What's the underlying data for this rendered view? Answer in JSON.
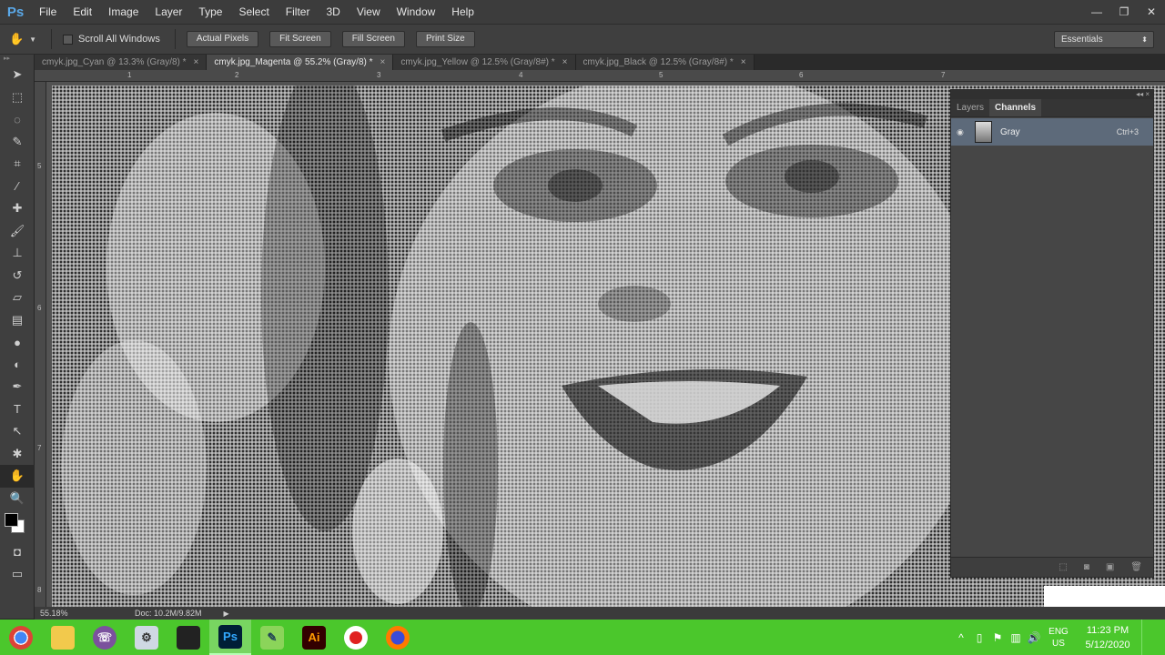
{
  "app": {
    "logo": "Ps"
  },
  "menu": [
    "File",
    "Edit",
    "Image",
    "Layer",
    "Type",
    "Select",
    "Filter",
    "3D",
    "View",
    "Window",
    "Help"
  ],
  "window_controls": {
    "minimize": "—",
    "restore": "❐",
    "close": "✕"
  },
  "options": {
    "tool_icon": "hand-icon",
    "scroll_all_windows": "Scroll All Windows",
    "buttons": [
      "Actual Pixels",
      "Fit Screen",
      "Fill Screen",
      "Print Size"
    ],
    "workspace": "Essentials"
  },
  "tabs": [
    {
      "label": "cmyk.jpg_Cyan @ 13.3% (Gray/8) *",
      "active": false
    },
    {
      "label": "cmyk.jpg_Magenta @ 55.2% (Gray/8) *",
      "active": true
    },
    {
      "label": "cmyk.jpg_Yellow @ 12.5% (Gray/8#) *",
      "active": false
    },
    {
      "label": "cmyk.jpg_Black @ 12.5% (Gray/8#) *",
      "active": false
    }
  ],
  "ruler_h": [
    "1",
    "2",
    "3",
    "4",
    "5",
    "6",
    "7"
  ],
  "ruler_v": [
    "5",
    "6",
    "7",
    "8"
  ],
  "tools": [
    "move-icon",
    "marquee-icon",
    "lasso-icon",
    "quick-select-icon",
    "crop-icon",
    "eyedropper-icon",
    "healing-icon",
    "brush-icon",
    "stamp-icon",
    "history-brush-icon",
    "eraser-icon",
    "gradient-icon",
    "blur-icon",
    "dodge-icon",
    "pen-icon",
    "type-icon",
    "path-select-icon",
    "shape-icon",
    "hand-icon",
    "zoom-icon"
  ],
  "colors": {
    "foreground": "#000000",
    "background": "#ffffff",
    "taskbar": "#4bc72c",
    "channel_selected": "#5d6a7a"
  },
  "panel": {
    "tabs": [
      "Layers",
      "Channels"
    ],
    "active_tab": "Channels",
    "channel": {
      "name": "Gray",
      "shortcut": "Ctrl+3"
    }
  },
  "status": {
    "zoom": "55.18%",
    "doc": "Doc: 10.2M/9.82M"
  },
  "taskbar": {
    "apps": [
      "chrome-icon",
      "explorer-icon",
      "viber-icon",
      "network-icon",
      "dark-app-icon",
      "photoshop-icon",
      "pencil-app-icon",
      "illustrator-icon",
      "record-icon",
      "firefox-icon"
    ],
    "running": [
      "photoshop-icon"
    ],
    "lang": [
      "ENG",
      "US"
    ],
    "time": "11:23 PM",
    "date": "5/12/2020"
  }
}
